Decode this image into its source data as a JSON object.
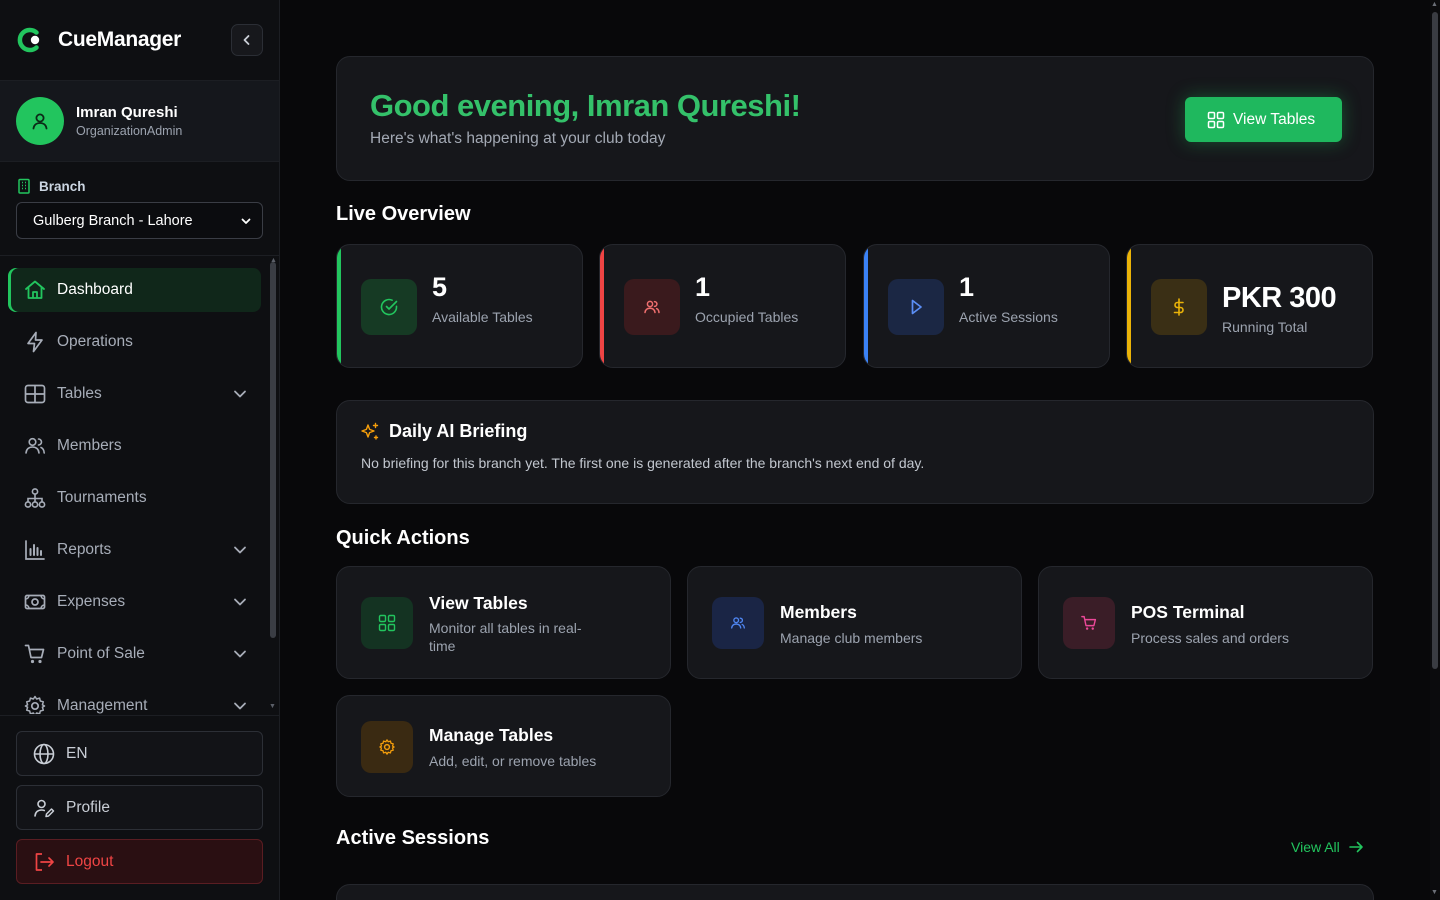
{
  "app": {
    "name": "CueManager"
  },
  "user": {
    "name": "Imran Qureshi",
    "role": "OrganizationAdmin"
  },
  "branch": {
    "label": "Branch",
    "selected": "Gulberg Branch - Lahore"
  },
  "nav": {
    "items": [
      {
        "label": "Dashboard",
        "icon": "home-icon",
        "active": true,
        "expandable": false
      },
      {
        "label": "Operations",
        "icon": "lightning-icon",
        "active": false,
        "expandable": false
      },
      {
        "label": "Tables",
        "icon": "grid-icon",
        "active": false,
        "expandable": true
      },
      {
        "label": "Members",
        "icon": "users-icon",
        "active": false,
        "expandable": false
      },
      {
        "label": "Tournaments",
        "icon": "hierarchy-icon",
        "active": false,
        "expandable": false
      },
      {
        "label": "Reports",
        "icon": "bar-chart-icon",
        "active": false,
        "expandable": true
      },
      {
        "label": "Expenses",
        "icon": "banknote-icon",
        "active": false,
        "expandable": true
      },
      {
        "label": "Point of Sale",
        "icon": "cart-icon",
        "active": false,
        "expandable": true
      },
      {
        "label": "Management",
        "icon": "gear-icon",
        "active": false,
        "expandable": true
      }
    ]
  },
  "sidebar_footer": {
    "language": "EN",
    "profile": "Profile",
    "logout": "Logout"
  },
  "greeting": {
    "title": "Good evening, Imran Qureshi!",
    "subtitle": "Here's what's happening at your club today",
    "button": "View Tables"
  },
  "live_overview": {
    "title": "Live Overview",
    "stats": [
      {
        "value": "5",
        "label": "Available Tables",
        "color": "#22c55e",
        "icon": "check-circle-icon"
      },
      {
        "value": "1",
        "label": "Occupied Tables",
        "color": "#ef4444",
        "icon": "users-icon"
      },
      {
        "value": "1",
        "label": "Active Sessions",
        "color": "#3b82f6",
        "icon": "play-icon"
      },
      {
        "value": "PKR 300",
        "label": "Running Total",
        "color": "#eab308",
        "icon": "dollar-icon"
      }
    ]
  },
  "briefing": {
    "title": "Daily AI Briefing",
    "text": "No briefing for this branch yet. The first one is generated after the branch's next end of day."
  },
  "quick_actions": {
    "title": "Quick Actions",
    "items": [
      {
        "title": "View Tables",
        "subtitle": "Monitor all tables in real-time",
        "icon": "grid-icon",
        "color": "#22c55e"
      },
      {
        "title": "Members",
        "subtitle": "Manage club members",
        "icon": "users-icon",
        "color": "#3b82f6"
      },
      {
        "title": "POS Terminal",
        "subtitle": "Process sales and orders",
        "icon": "cart-icon",
        "color": "#ec4899"
      },
      {
        "title": "Manage Tables",
        "subtitle": "Add, edit, or remove tables",
        "icon": "gear-icon",
        "color": "#f59e0b"
      }
    ]
  },
  "active_sessions": {
    "title": "Active Sessions",
    "view_all": "View All"
  },
  "colors": {
    "accent": "#22c55e",
    "background": "#08080a",
    "card": "#16171b"
  }
}
